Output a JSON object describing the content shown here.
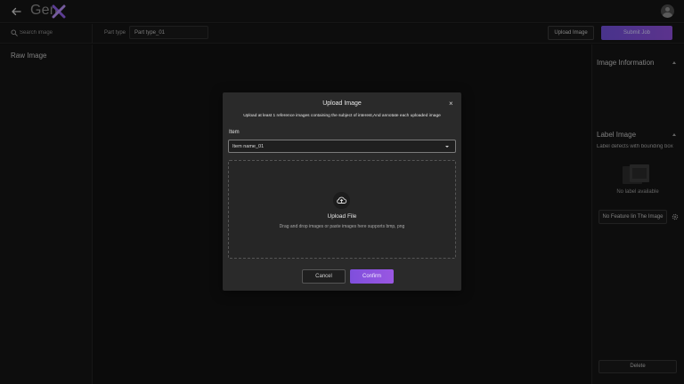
{
  "app": {
    "name": "Gen",
    "brand_color": "#8e5ee3"
  },
  "icons": {
    "back": "arrow-left-icon",
    "logo_mark": "x-mark-icon",
    "avatar": "user-icon",
    "search": "search-icon",
    "upload": "cloud-upload-icon",
    "settings": "gear-icon",
    "placeholder_image": "image-icon"
  },
  "toolbar": {
    "search_placeholder": "Search image",
    "part_type_label": "Part type",
    "part_type_value": "Part type_01",
    "upload_image_label": "Upload Image",
    "submit_job_label": "Submit Job"
  },
  "left_panel": {
    "title": "Raw Image"
  },
  "right_panel": {
    "image_information_title": "Image Information",
    "label_image_title": "Label Image",
    "label_hint": "Label defects with bounding box",
    "no_label_text": "No label available",
    "no_feature_button": "No Feature lin The Image",
    "delete_button": "Delete"
  },
  "modal": {
    "title": "Upload Image",
    "close_symbol": "×",
    "subtitle": "Upload at least 1 reference images containing the subject of interest,And annotate each uploaded image",
    "item_label": "Item",
    "item_value": "Item name_01",
    "upload_title": "Upload File",
    "upload_hint": "Drag and drop images or paste images here supports bmp, png",
    "cancel_label": "Cancel",
    "confirm_label": "Confirm"
  }
}
